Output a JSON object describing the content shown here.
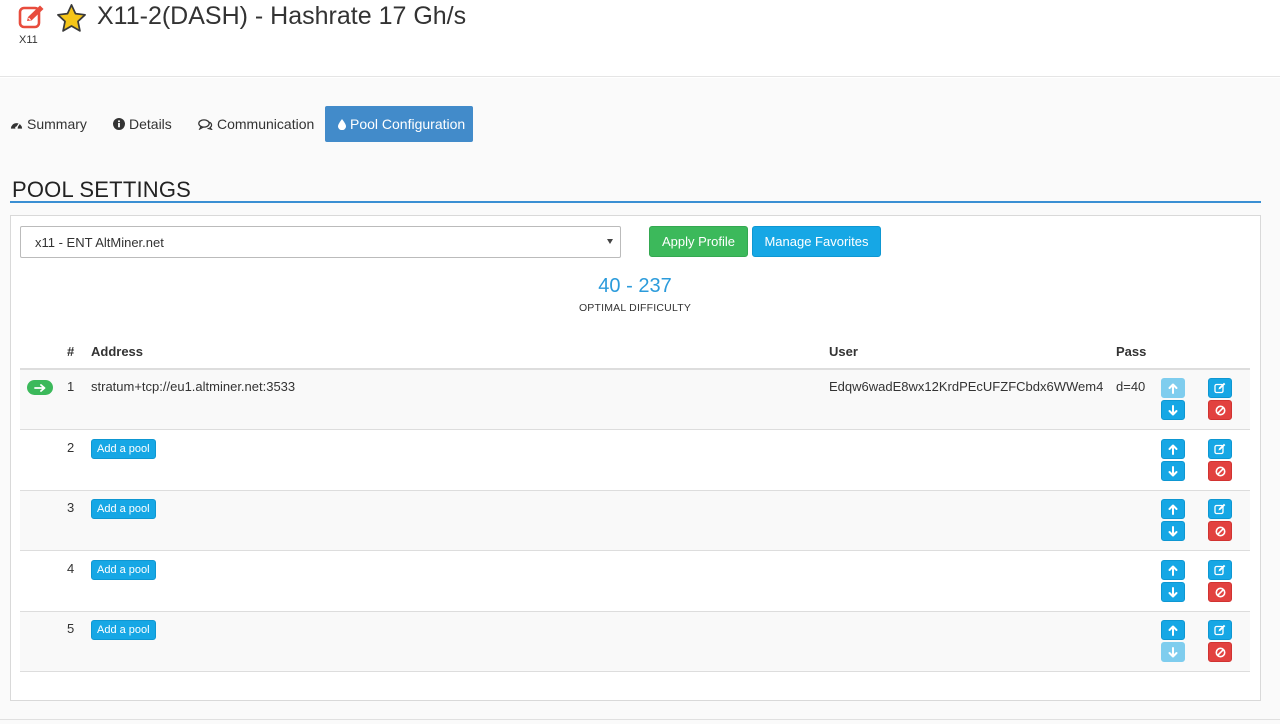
{
  "header": {
    "algo_label": "X11",
    "title": "X11-2(DASH) - Hashrate 17 Gh/s",
    "icons": {
      "edit": "edit-icon",
      "favorite": "star-icon"
    },
    "colors": {
      "edit_icon": "#e84c3d",
      "star": "#f5c518"
    }
  },
  "tabs": [
    {
      "label": "Summary",
      "icon": "dashboard-icon",
      "active": false
    },
    {
      "label": "Details",
      "icon": "info-circle-icon",
      "active": false
    },
    {
      "label": "Communication",
      "icon": "comments-icon",
      "active": false
    },
    {
      "label": "Pool Configuration",
      "icon": "tint-icon",
      "active": true
    }
  ],
  "pool_settings": {
    "title": "POOL SETTINGS",
    "profile_select": {
      "value": "x11 - ENT AltMiner.net"
    },
    "apply_profile_label": "Apply Profile",
    "manage_favorites_label": "Manage Favorites",
    "difficulty": {
      "value": "40 - 237",
      "label": "OPTIMAL DIFFICULTY"
    },
    "columns": {
      "number": "#",
      "address": "Address",
      "user": "User",
      "pass": "Pass"
    },
    "rows": [
      {
        "number": "1",
        "address": "stratum+tcp://eu1.altminer.net:3533",
        "user": "Edqw6wadE8wx12KrdPEcUFZFCbdx6WWem4",
        "pass": "d=40",
        "active": true,
        "up_enabled": false,
        "down_enabled": true
      },
      {
        "number": "2",
        "add_pool_label": "Add a pool",
        "up_enabled": true,
        "down_enabled": true
      },
      {
        "number": "3",
        "add_pool_label": "Add a pool",
        "up_enabled": true,
        "down_enabled": true
      },
      {
        "number": "4",
        "add_pool_label": "Add a pool",
        "up_enabled": true,
        "down_enabled": true
      },
      {
        "number": "5",
        "add_pool_label": "Add a pool",
        "up_enabled": true,
        "down_enabled": false
      }
    ],
    "colors": {
      "primary": "#428bca",
      "info": "#16a7e5",
      "success": "#3cb95b",
      "danger": "#e2413f",
      "difficulty": "#2b9bdb"
    }
  }
}
